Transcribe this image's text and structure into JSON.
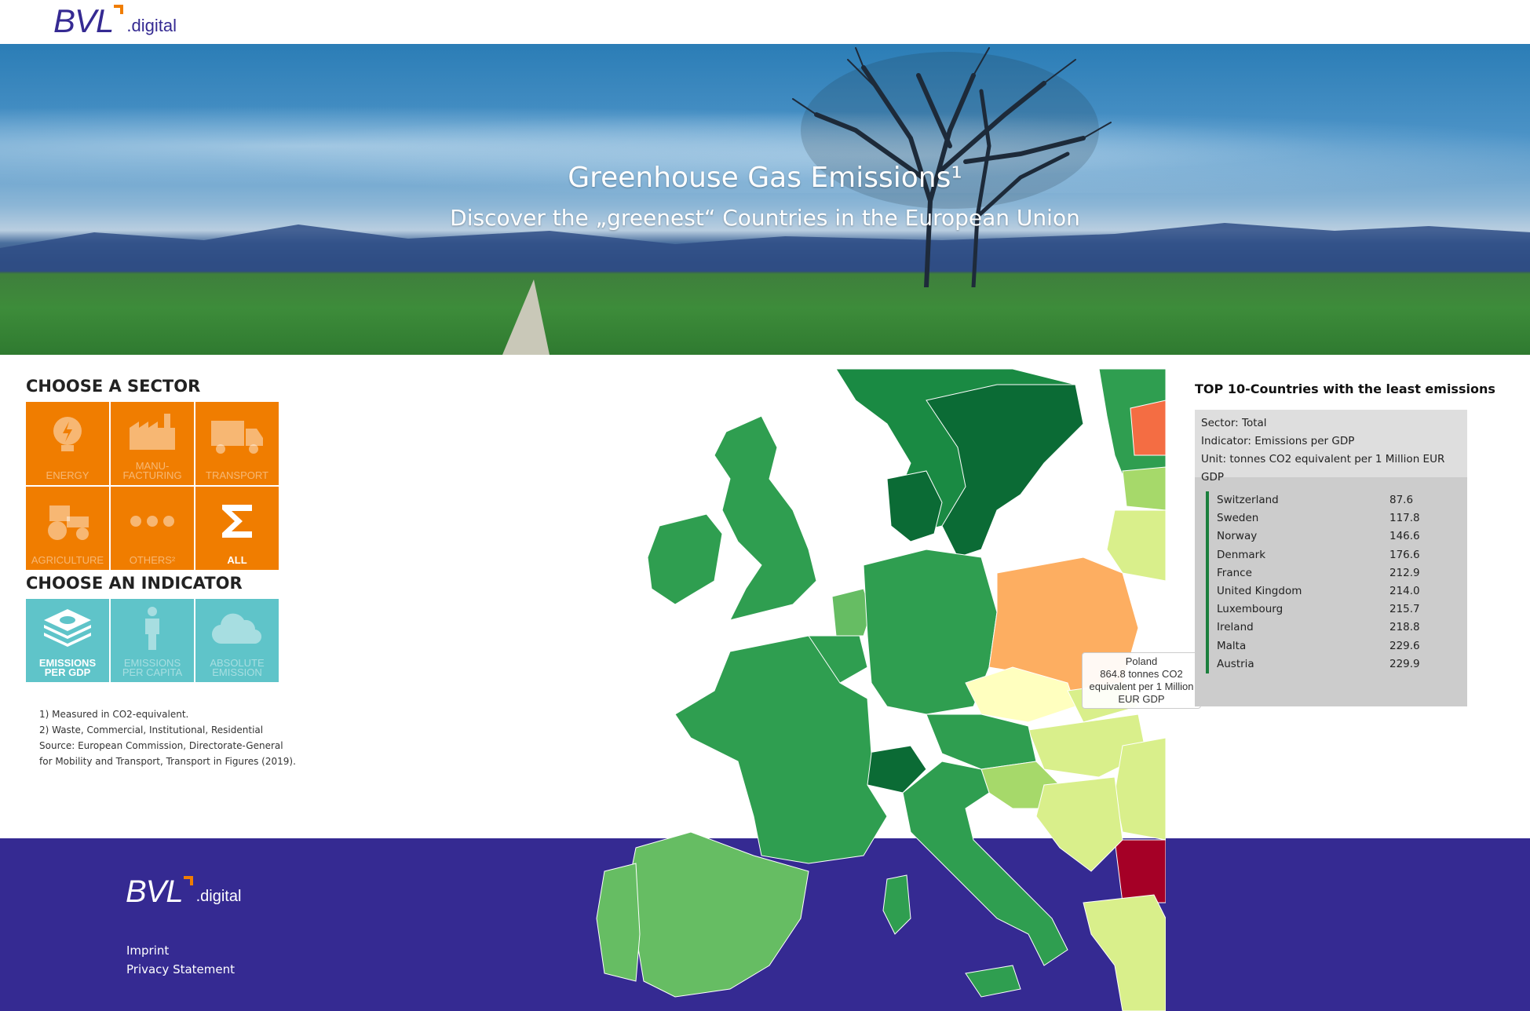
{
  "header": {
    "logo_main": "BVL",
    "logo_suffix": ".digital"
  },
  "hero": {
    "title": "Greenhouse Gas Emissions¹",
    "subtitle": "Discover the „greenest“ Countries in the European Union"
  },
  "sector": {
    "title": "CHOOSE A SECTOR",
    "items": [
      {
        "label": "ENERGY",
        "icon": "lightbulb-icon",
        "active": false
      },
      {
        "label": "MANU-\nFACTURING",
        "icon": "factory-icon",
        "active": false
      },
      {
        "label": "TRANSPORT",
        "icon": "truck-icon",
        "active": false
      },
      {
        "label": "AGRICULTURE",
        "icon": "tractor-icon",
        "active": false
      },
      {
        "label": "OTHERS²",
        "icon": "ellipsis-icon",
        "active": false
      },
      {
        "label": "ALL",
        "icon": "sigma-icon",
        "active": true
      }
    ]
  },
  "indicator": {
    "title": "CHOOSE AN INDICATOR",
    "items": [
      {
        "label": "EMISSIONS\nPER GDP",
        "icon": "money-stack-icon",
        "active": true
      },
      {
        "label": "EMISSIONS\nPER CAPITA",
        "icon": "person-icon",
        "active": false
      },
      {
        "label": "ABSOLUTE\nEMISSION",
        "icon": "cloud-icon",
        "active": false
      }
    ]
  },
  "notes": {
    "line1": "1) Measured in CO2-equivalent.",
    "line2": "2) Waste, Commercial, Institutional, Residential",
    "line3": "Source: European Commission, Directorate-General",
    "line4": "for Mobility and Transport, Transport in Figures (2019)."
  },
  "map": {
    "tooltip": {
      "country": "Poland",
      "value_text": "864.8 tonnes CO2",
      "unit_line1": "equivalent per 1 Million",
      "unit_line2": "EUR GDP"
    },
    "colors": {
      "darkest_green": "#0b6b35",
      "dark_green": "#1a8a43",
      "green": "#2f9e50",
      "mid_green": "#66bd63",
      "light_green": "#a6d96a",
      "yellow_green": "#d9ef8b",
      "pale_yellow": "#ffffbf",
      "light_orange": "#fdae61",
      "orange_red": "#f46d43",
      "dark_red": "#a50026",
      "sea": "#ffffff"
    }
  },
  "top10": {
    "title": "TOP 10-Countries with the least emissions",
    "sector": "Sector: Total",
    "indicator": "Indicator: Emissions per GDP",
    "unit": "Unit: tonnes CO2 equivalent per 1 Million EUR GDP",
    "rows": [
      {
        "country": "Switzerland",
        "value": "87.6"
      },
      {
        "country": "Sweden",
        "value": "117.8"
      },
      {
        "country": "Norway",
        "value": "146.6"
      },
      {
        "country": "Denmark",
        "value": "176.6"
      },
      {
        "country": "France",
        "value": "212.9"
      },
      {
        "country": "United Kingdom",
        "value": "214.0"
      },
      {
        "country": "Luxembourg",
        "value": "215.7"
      },
      {
        "country": "Ireland",
        "value": "218.8"
      },
      {
        "country": "Malta",
        "value": "229.6"
      },
      {
        "country": "Austria",
        "value": "229.9"
      }
    ]
  },
  "footer": {
    "logo_main": "BVL",
    "logo_suffix": ".digital",
    "imprint": "Imprint",
    "privacy": "Privacy Statement"
  }
}
